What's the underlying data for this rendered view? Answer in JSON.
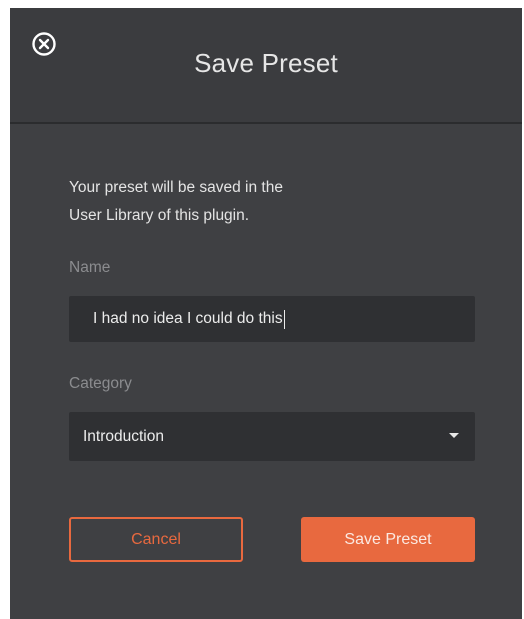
{
  "dialog": {
    "title": "Save Preset",
    "close_icon": "close-circle-icon",
    "description_line1": "Your preset will be saved in the",
    "description_line2": "User Library of this plugin.",
    "name": {
      "label": "Name",
      "value": "I had no idea I could do this"
    },
    "category": {
      "label": "Category",
      "selected": "Introduction",
      "arrow_icon": "caret-down-icon"
    },
    "buttons": {
      "cancel_label": "Cancel",
      "save_label": "Save Preset"
    }
  },
  "colors": {
    "accent": "#e8693f",
    "background": "#3f4043",
    "input_background": "#2f3033",
    "muted_text": "#8b8c8f"
  }
}
